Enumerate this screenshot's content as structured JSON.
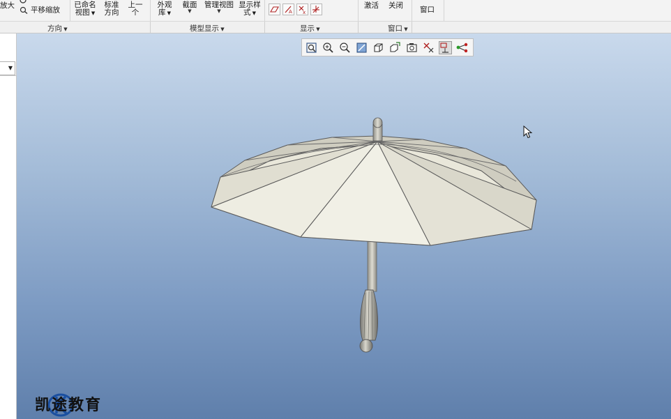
{
  "ribbon": {
    "zoom_in_fragment": "放大",
    "pan_zoom": "平移缩放",
    "named_views_line1": "已命名",
    "named_views_line2": "视图",
    "standard_orient_line1": "标准",
    "standard_orient_line2": "方向",
    "previous_line1": "上一",
    "previous_line2": "个",
    "appearance_line1": "外观",
    "appearance_line2": "库",
    "section": "截面",
    "manage_views": "管理视图",
    "display_style_line1": "显示样",
    "display_style_line2": "式",
    "activate": "激活",
    "close": "关闭",
    "window": "窗口",
    "groups": {
      "orientation": "方向",
      "model_display": "模型显示",
      "show": "显示",
      "window": "窗口"
    }
  },
  "viewport": {
    "background_top": "#c9d9ec",
    "background_bottom": "#5f7fab",
    "toolbar_icons": [
      "refit-icon",
      "zoom-in-icon",
      "zoom-out-icon",
      "repaint-icon",
      "display-style-icon",
      "saved-orientations-icon",
      "view-manager-icon",
      "datum-display-icon",
      "annotation-display-icon",
      "spin-center-icon"
    ]
  },
  "model": {
    "object": "umbrella",
    "canopy_color": "#efeee2",
    "edge_color": "#5a5a5a"
  },
  "watermark": {
    "text": "凯途教育"
  }
}
